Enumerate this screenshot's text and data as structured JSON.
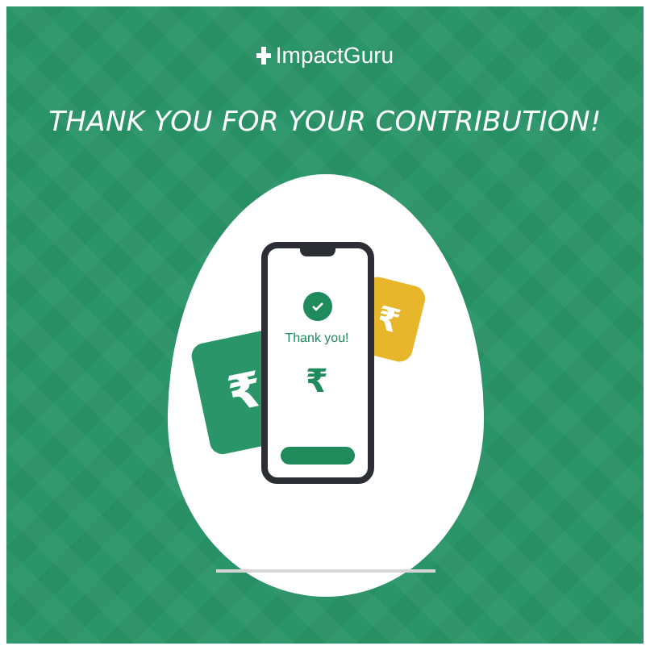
{
  "header": {
    "logo": "ImpactGuru",
    "heading": "THANK YOU FOR YOUR CONTRIBUTION!"
  },
  "illustration": {
    "left_card": "₹",
    "right_card": "₹",
    "phone": {
      "title": "Thank you!",
      "amount_symbol": "₹"
    }
  }
}
